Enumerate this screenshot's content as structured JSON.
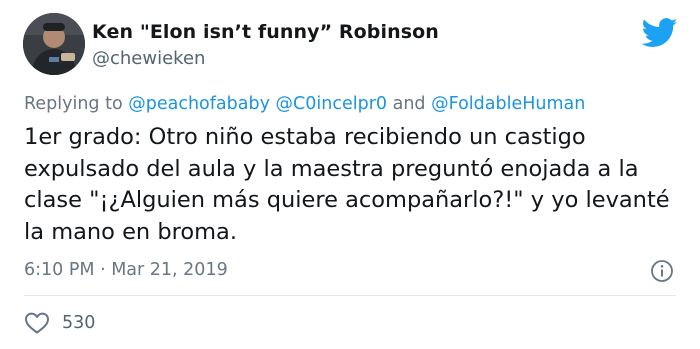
{
  "author": {
    "display_name": "Ken \"Elon isn’t funny” Robinson",
    "handle": "@chewieken",
    "avatar_icon": "profile-photo"
  },
  "reply_context": {
    "prefix": "Replying to",
    "mention_1": "@peachofababy",
    "mention_2": "@C0incelpr0",
    "conjunction": "and",
    "mention_3": "@FoldableHuman"
  },
  "tweet": {
    "text": "1er grado: Otro niño estaba recibiendo un castigo expulsado del aula y la maestra preguntó enojada a la clase \"¡¿Alguien más quiere acompañarlo?!\" y yo levanté la mano en broma.",
    "timestamp": "6:10 PM · Mar 21, 2019"
  },
  "engagement": {
    "likes": "530",
    "like_icon": "heart-icon"
  },
  "icons": {
    "brand": "twitter-bird-icon",
    "info": "info-icon"
  },
  "colors": {
    "brand_blue": "#1da1f2",
    "mention_blue": "#1b95e0",
    "secondary_text": "#687684",
    "primary_text": "#14171a"
  }
}
